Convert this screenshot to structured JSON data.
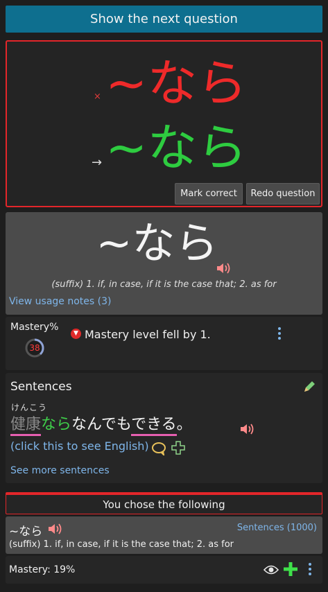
{
  "next_button": "Show the next question",
  "answer": {
    "wrong_mark": "×",
    "wrong_text": "~なら",
    "arrow": "→",
    "correct_text": "~なら",
    "mark_correct": "Mark correct",
    "redo": "Redo question"
  },
  "vocab": {
    "word": "~なら",
    "meaning": "(suffix) 1. if, in case, if it is the case that; 2. as for",
    "usage_link": "View usage notes (3)"
  },
  "mastery": {
    "label": "Mastery%",
    "value": "38",
    "percent": 38,
    "message": "Mastery level fell by 1."
  },
  "sentences": {
    "title": "Sentences",
    "furigana": "けんこう",
    "parts": [
      "健康",
      "なら",
      "なんでも",
      "できる",
      "。"
    ],
    "click_english": "(click this to see English)",
    "see_more": "See more sentences"
  },
  "chose": {
    "header": "You chose the following",
    "word": "~なら",
    "sentences_link": "Sentences (1000)",
    "meaning": "(suffix) 1. if, in case, if it is the case that; 2. as for",
    "mastery_label": "Mastery: 19%"
  },
  "colors": {
    "accent_button": "#0e6f8f",
    "wrong": "#ee2a2a",
    "correct": "#2ecc40",
    "link": "#7fb6ea"
  }
}
